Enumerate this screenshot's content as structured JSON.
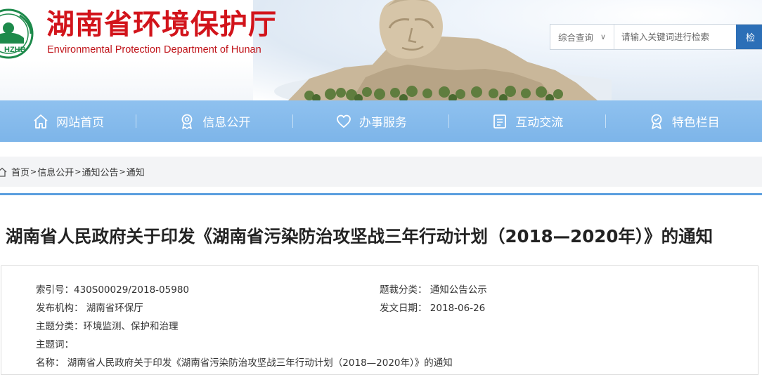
{
  "header": {
    "title": "湖南省环境保护厅",
    "subtitle": "Environmental Protection Department of Hunan",
    "logo_text": "HZHB"
  },
  "search": {
    "scope": "综合查询",
    "placeholder": "请输入关键词进行检索",
    "button": "检 索"
  },
  "nav": {
    "items": [
      {
        "label": "网站首页",
        "icon": "home-icon"
      },
      {
        "label": "信息公开",
        "icon": "award-icon"
      },
      {
        "label": "办事服务",
        "icon": "heart-icon"
      },
      {
        "label": "互动交流",
        "icon": "document-icon"
      },
      {
        "label": "特色栏目",
        "icon": "badge-icon"
      }
    ]
  },
  "breadcrumb": {
    "items": [
      "首页",
      "信息公开",
      "通知公告",
      "通知"
    ],
    "separator": ">"
  },
  "article": {
    "title": "湖南省人民政府关于印发《湖南省污染防治攻坚战三年行动计划（2018—2020年）》的通知",
    "meta": {
      "index_label": "索引号：",
      "index_value": "430S00029/2018-05980",
      "category_label": "题裁分类：",
      "category_value": "通知公告公示",
      "publisher_label": "发布机构：",
      "publisher_value": "湖南省环保厅",
      "date_label": "发文日期：",
      "date_value": "2018-06-26",
      "topic_label": "主题分类：",
      "topic_value": "环境监测、保护和治理",
      "keywords_label": "主题词：",
      "keywords_value": "",
      "name_label": "名称：",
      "name_value": "湖南省人民政府关于印发《湖南省污染防治攻坚战三年行动计划（2018—2020年）》的通知"
    }
  },
  "colors": {
    "brand_red": "#d2141b",
    "nav_blue": "#86bbec",
    "accent_blue": "#2c6fb7",
    "divider_blue": "#5b9fdf"
  }
}
